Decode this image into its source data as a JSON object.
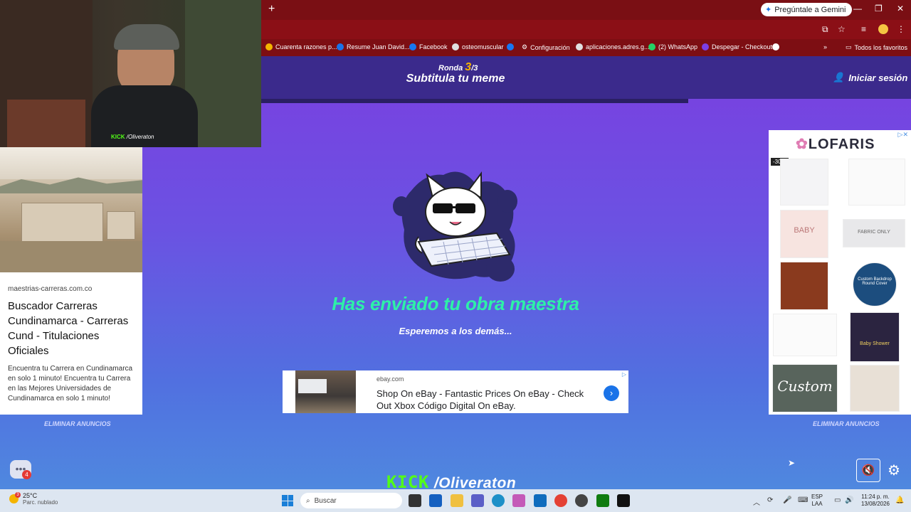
{
  "browser": {
    "new_tab": "+",
    "gemini_label": "Pregúntale a Gemini",
    "bookmarks": [
      "Cuarenta razones p...",
      "Resume Juan David...",
      "Facebook",
      "osteomuscular",
      "",
      "Configuración",
      "aplicaciones.adres.g...",
      "(2) WhatsApp",
      "Despegar - Checkout",
      ""
    ],
    "all_favorites": "Todos los favoritos"
  },
  "header": {
    "round_label": "Ronda",
    "round_number": "3",
    "round_total": "/3",
    "title": "Subtitula tu meme",
    "login": "Iniciar sesión"
  },
  "main": {
    "sent_title": "Has enviado tu obra maestra",
    "wait_text": "Esperemos a los demás..."
  },
  "ads": {
    "ebay": {
      "domain": "ebay.com",
      "headline": "Shop On eBay - Fantastic Prices On eBay - Check Out Xbox Código Digital On eBay."
    },
    "left": {
      "domain": "maestrias-carreras.com.co",
      "title": "Buscador Carreras Cundinamarca - Carreras Cund - Titulaciones Oficiales",
      "description": "Encuentra tu Carrera en Cundinamarca en solo 1 minuto! Encuentra tu Carrera en las Mejores Universidades de Cundinamarca en solo 1 minuto!"
    },
    "right": {
      "brand": "LOFARIS",
      "discount": "-30%",
      "products": [
        "BABY",
        "FABRIC ONLY",
        "Custom Backdrop Round Cover",
        "Baby Shower",
        "Custom"
      ]
    },
    "remove_label": "ELIMINAR ANUNCIOS"
  },
  "webcam": {
    "brand": "KICK",
    "user": "/Oliveraton"
  },
  "footer": {
    "chat_badge": "4",
    "kick": "KICK",
    "user": "/Oliveraton"
  },
  "taskbar": {
    "weather_badge": "3",
    "temperature": "25°C",
    "condition": "Parc. nublado",
    "search_placeholder": "Buscar",
    "lang": "ESP",
    "lang2": "LAA",
    "time": "11:24 p. m.",
    "date": "13/08/2026"
  },
  "colors": {
    "accent_green": "#2ef0a8",
    "kick_green": "#53fc18",
    "header_bg": "#3b2a8c"
  }
}
